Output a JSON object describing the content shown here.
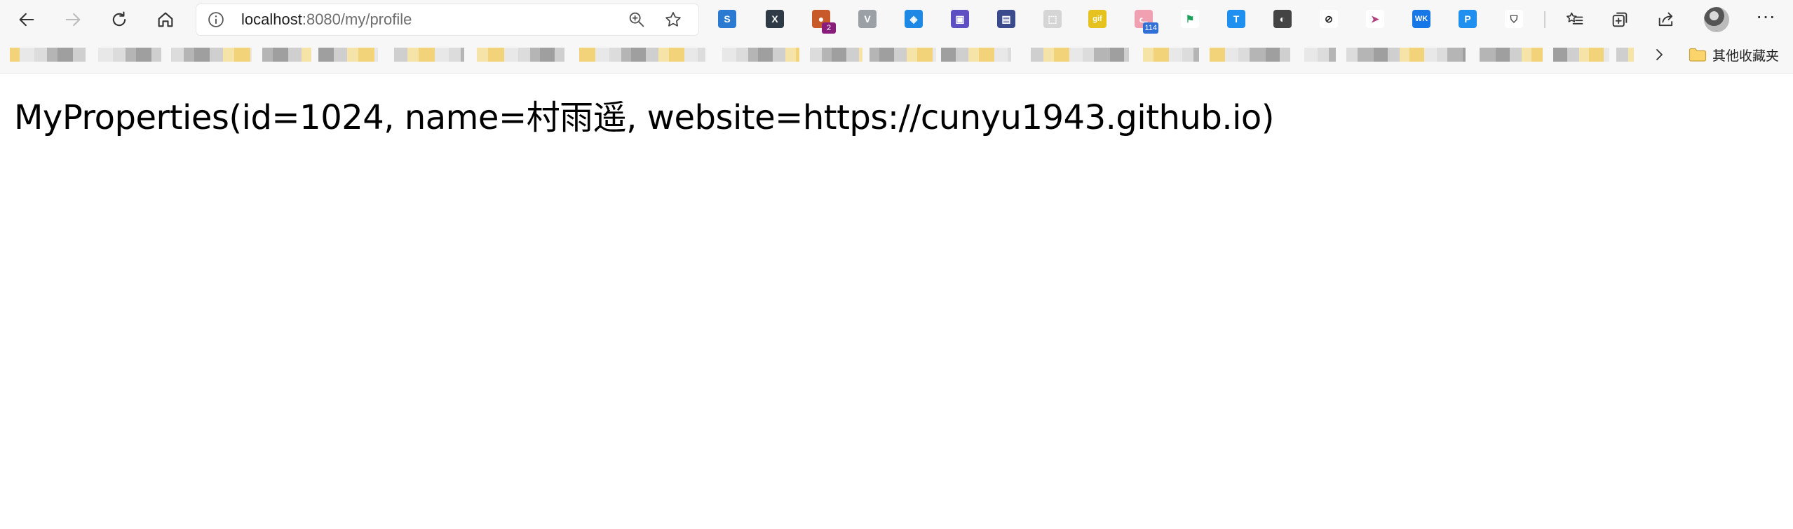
{
  "browser": {
    "url_host": "localhost",
    "url_path": ":8080/my/profile",
    "extensions": [
      {
        "name": "s-ext-icon",
        "bg": "#2a7ad1",
        "glyph": "S"
      },
      {
        "name": "x-ext-icon",
        "bg": "#2e3a46",
        "glyph": "X"
      },
      {
        "name": "cookie-ext-icon",
        "bg": "#c85a2a",
        "glyph": "●",
        "badge": "2",
        "badge_bg": "#8a1c7c"
      },
      {
        "name": "v-ext-icon",
        "bg": "#9aa0a6",
        "glyph": "V"
      },
      {
        "name": "cube-ext-icon",
        "bg": "#1e88e5",
        "glyph": "◈"
      },
      {
        "name": "box-ext-icon",
        "bg": "#5e4fc2",
        "glyph": "▣"
      },
      {
        "name": "window-ext-icon",
        "bg": "#3b4a8c",
        "glyph": "▤"
      },
      {
        "name": "screenshot-ext-icon",
        "bg": "#d5d5d5",
        "glyph": "⬚"
      },
      {
        "name": "gif-ext-icon",
        "bg": "#e6c21f",
        "glyph": "gif"
      },
      {
        "name": "cat-ext-icon",
        "bg": "#f0a0b0",
        "glyph": "ᓚ",
        "badge": "114",
        "badge_bg": "#2f6fd6"
      },
      {
        "name": "flag-ext-icon",
        "bg": "#ffffff",
        "glyph": "⚑",
        "fg": "#19a05a"
      },
      {
        "name": "t-ext-icon",
        "bg": "#1f8ff0",
        "glyph": "T"
      },
      {
        "name": "circle-ext-icon",
        "bg": "#444444",
        "glyph": "◐"
      },
      {
        "name": "link-ext-icon",
        "bg": "#ffffff",
        "glyph": "⊘",
        "fg": "#222"
      },
      {
        "name": "cursor-ext-icon",
        "bg": "#ffffff",
        "glyph": "➤",
        "fg": "#b04080"
      },
      {
        "name": "wk-ext-icon",
        "bg": "#1777e6",
        "glyph": "WK"
      },
      {
        "name": "p-ext-icon",
        "bg": "#1f8ff0",
        "glyph": "P"
      },
      {
        "name": "shield-ext-icon",
        "bg": "#ffffff",
        "glyph": "⛉",
        "fg": "#333"
      }
    ],
    "bookmarks_folder_label": "其他收藏夹"
  },
  "page": {
    "text": "MyProperties(id=1024, name=村雨遥, website=https://cunyu1943.github.io)"
  }
}
